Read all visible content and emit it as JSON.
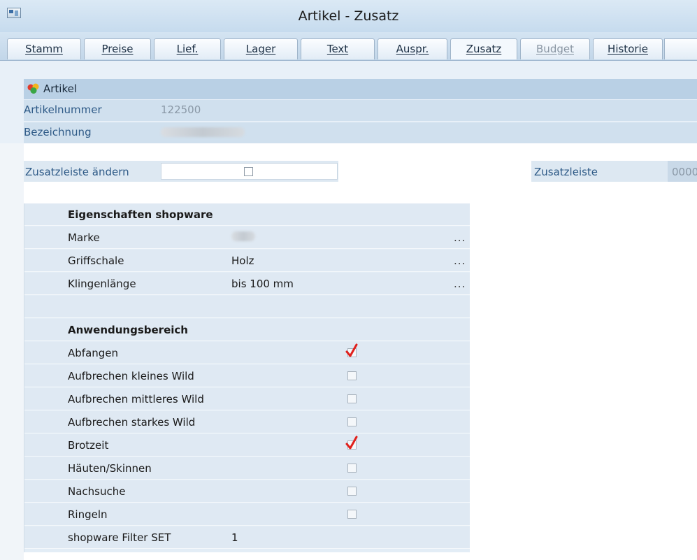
{
  "window": {
    "title": "Artikel - Zusatz"
  },
  "tabs": [
    {
      "label": "Stamm",
      "state": "normal"
    },
    {
      "label": "Preise",
      "state": "normal"
    },
    {
      "label": "Lief.",
      "state": "normal"
    },
    {
      "label": "Lager",
      "state": "normal"
    },
    {
      "label": "Text",
      "state": "normal"
    },
    {
      "label": "Auspr.",
      "state": "normal"
    },
    {
      "label": "Zusatz",
      "state": "active"
    },
    {
      "label": "Budget",
      "state": "disabled"
    },
    {
      "label": "Historie",
      "state": "normal"
    }
  ],
  "artikel": {
    "header": "Artikel",
    "artikelnummer_label": "Artikelnummer",
    "artikelnummer_value": "122500",
    "bezeichnung_label": "Bezeichnung"
  },
  "zusatz": {
    "aendern_label": "Zusatzleiste ändern",
    "aendern_checked": false,
    "zusatzleiste_label": "Zusatzleiste",
    "zusatzleiste_value": "0000"
  },
  "properties": {
    "group1_title": "Eigenschaften shopware",
    "marke_label": "Marke",
    "griffschale_label": "Griffschale",
    "griffschale_value": "Holz",
    "klingenlaenge_label": "Klingenlänge",
    "klingenlaenge_value": "bis 100 mm",
    "ellipsis": "...",
    "group2_title": "Anwendungsbereich",
    "usage": [
      {
        "label": "Abfangen",
        "checked": true
      },
      {
        "label": "Aufbrechen kleines Wild",
        "checked": false
      },
      {
        "label": "Aufbrechen mittleres Wild",
        "checked": false
      },
      {
        "label": "Aufbrechen starkes Wild",
        "checked": false
      },
      {
        "label": "Brotzeit",
        "checked": true
      },
      {
        "label": "Häuten/Skinnen",
        "checked": false
      },
      {
        "label": "Nachsuche",
        "checked": false
      },
      {
        "label": "Ringeln",
        "checked": false
      }
    ],
    "filter_label": "shopware Filter SET",
    "filter_value": "1"
  },
  "colors": {
    "accent": "#b9d0e5",
    "check": "#e0201c"
  }
}
